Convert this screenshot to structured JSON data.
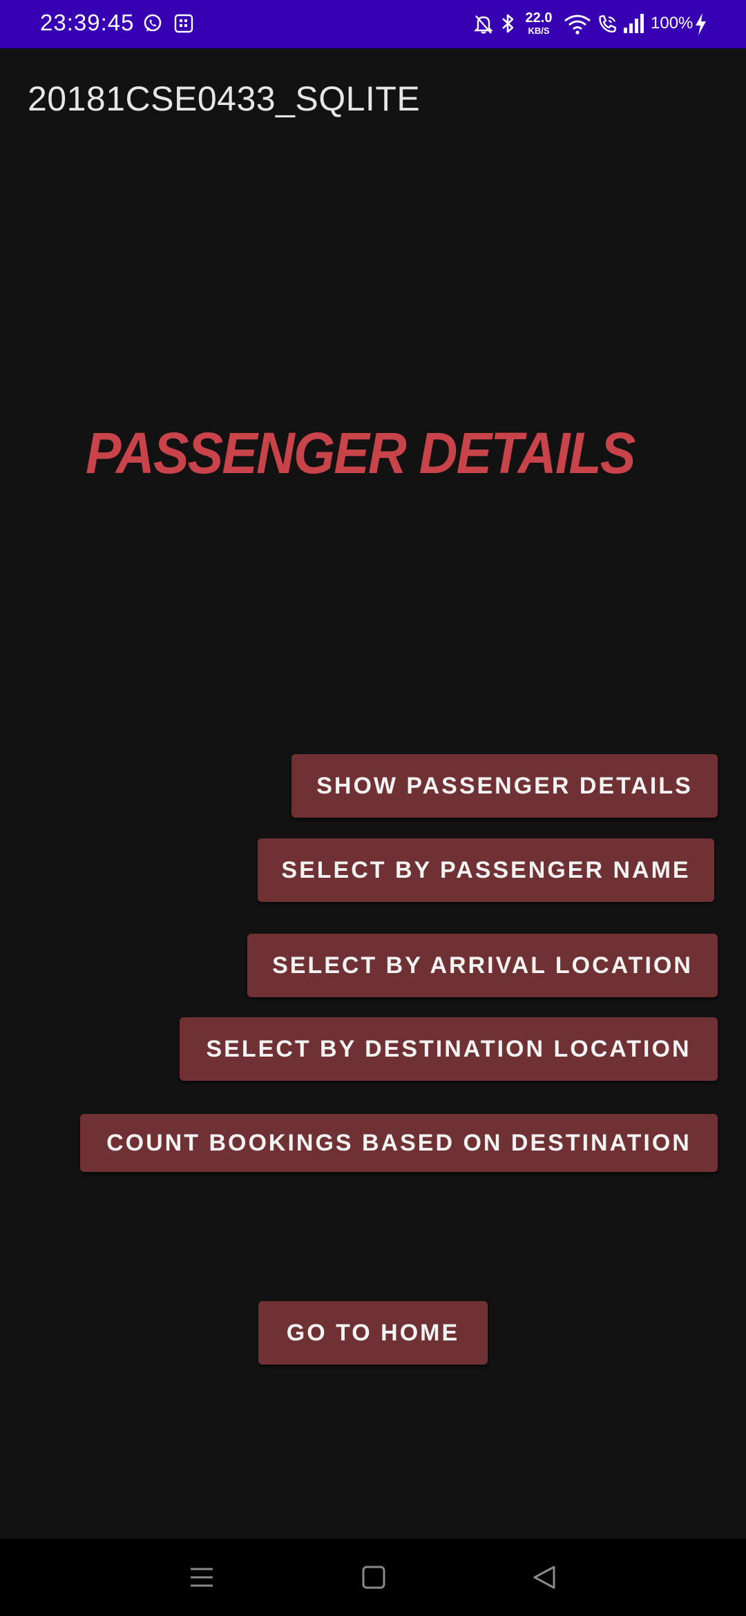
{
  "status_bar": {
    "time": "23:39:45",
    "network_speed_value": "22.0",
    "network_speed_unit": "KB/S",
    "battery": "100%",
    "background_color": "#3700b3",
    "icons": [
      "whatsapp-icon",
      "calendar-icon",
      "mute-bell-icon",
      "bluetooth-icon",
      "wifi-icon",
      "wifi-calling-icon",
      "signal-icon",
      "charging-bolt-icon"
    ]
  },
  "app_bar": {
    "title": "20181CSE0433_SQLITE"
  },
  "main": {
    "heading": "PASSENGER DETAILS",
    "heading_color": "#c9434a",
    "buttons": {
      "show_details": "SHOW PASSENGER DETAILS",
      "select_by_name": "SELECT BY PASSENGER NAME",
      "select_by_arrival": "SELECT BY ARRIVAL LOCATION",
      "select_by_destination": "SELECT BY DESTINATION LOCATION",
      "count_bookings": "COUNT BOOKINGS BASED ON DESTINATION",
      "go_home": "GO TO HOME"
    },
    "button_color": "#6f3133"
  },
  "nav_bar": {
    "icons": [
      "menu-icon",
      "home-square-icon",
      "back-triangle-icon"
    ]
  }
}
